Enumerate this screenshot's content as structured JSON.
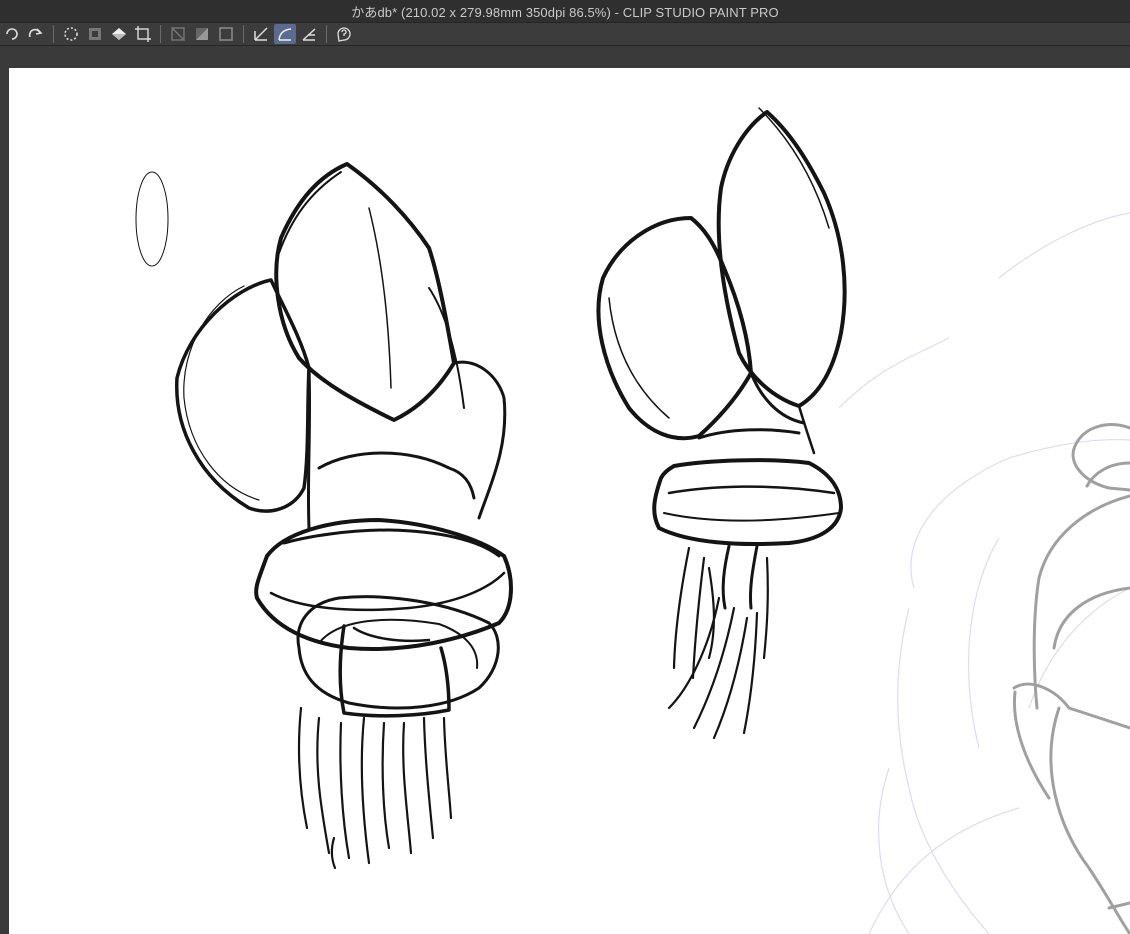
{
  "window": {
    "title": "かあdb* (210.02 x 279.98mm 350dpi 86.5%)  - CLIP STUDIO PAINT PRO"
  },
  "toolbar": {
    "buttons": [
      {
        "icon": "undo-icon"
      },
      {
        "icon": "redo-icon"
      },
      {
        "icon": "clear-selection-icon"
      },
      {
        "icon": "invert-selection-icon"
      },
      {
        "icon": "fill-icon"
      },
      {
        "icon": "transform-icon"
      },
      {
        "icon": "clear-layer-icon"
      },
      {
        "icon": "tone-icon"
      },
      {
        "icon": "border-icon"
      },
      {
        "icon": "ruler-snap-icon"
      },
      {
        "icon": "curve-snap-icon",
        "active": true
      },
      {
        "icon": "perspective-snap-icon"
      },
      {
        "icon": "help-icon"
      }
    ]
  },
  "canvas": {
    "background": "#ffffff",
    "ink_color": "#141414",
    "sketch_gray": "#a0a0a0",
    "sketch_lavender": "#dcdcf2"
  }
}
